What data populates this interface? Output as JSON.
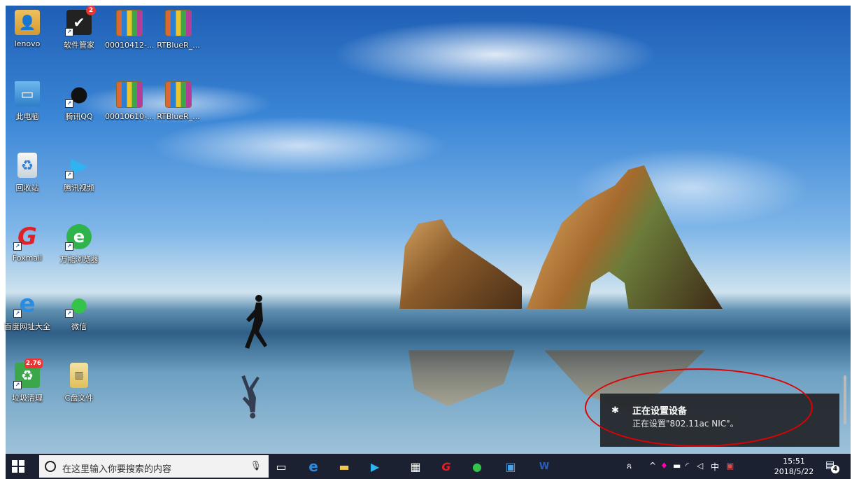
{
  "desktop": {
    "icons": [
      {
        "label": "lenovo"
      },
      {
        "label": "软件管家",
        "badge": "2"
      },
      {
        "label": "00010412-..."
      },
      {
        "label": "RTBlueR_..."
      },
      {
        "label": "此电脑"
      },
      {
        "label": "腾讯QQ"
      },
      {
        "label": "00010610-..."
      },
      {
        "label": "RTBlueR_..."
      },
      {
        "label": "回收站"
      },
      {
        "label": "腾讯视频"
      },
      {
        "label": "Foxmail"
      },
      {
        "label": "万能浏览器"
      },
      {
        "label": "百度网址大全"
      },
      {
        "label": "微信"
      },
      {
        "label": "垃圾清理",
        "badge": "2.76"
      },
      {
        "label": "C盘文件"
      }
    ]
  },
  "notification": {
    "title": "正在设置设备",
    "body": "正在设置\"802.11ac NIC\"。"
  },
  "taskbar": {
    "search_placeholder": "在这里输入你要搜索的内容",
    "ime": "中",
    "time": "15:51",
    "date": "2018/5/22",
    "notification_count": "4"
  },
  "colors": {
    "annotation_circle": "#e10000",
    "taskbar_bg": "#1b2130",
    "toast_bg": "#23262a"
  }
}
